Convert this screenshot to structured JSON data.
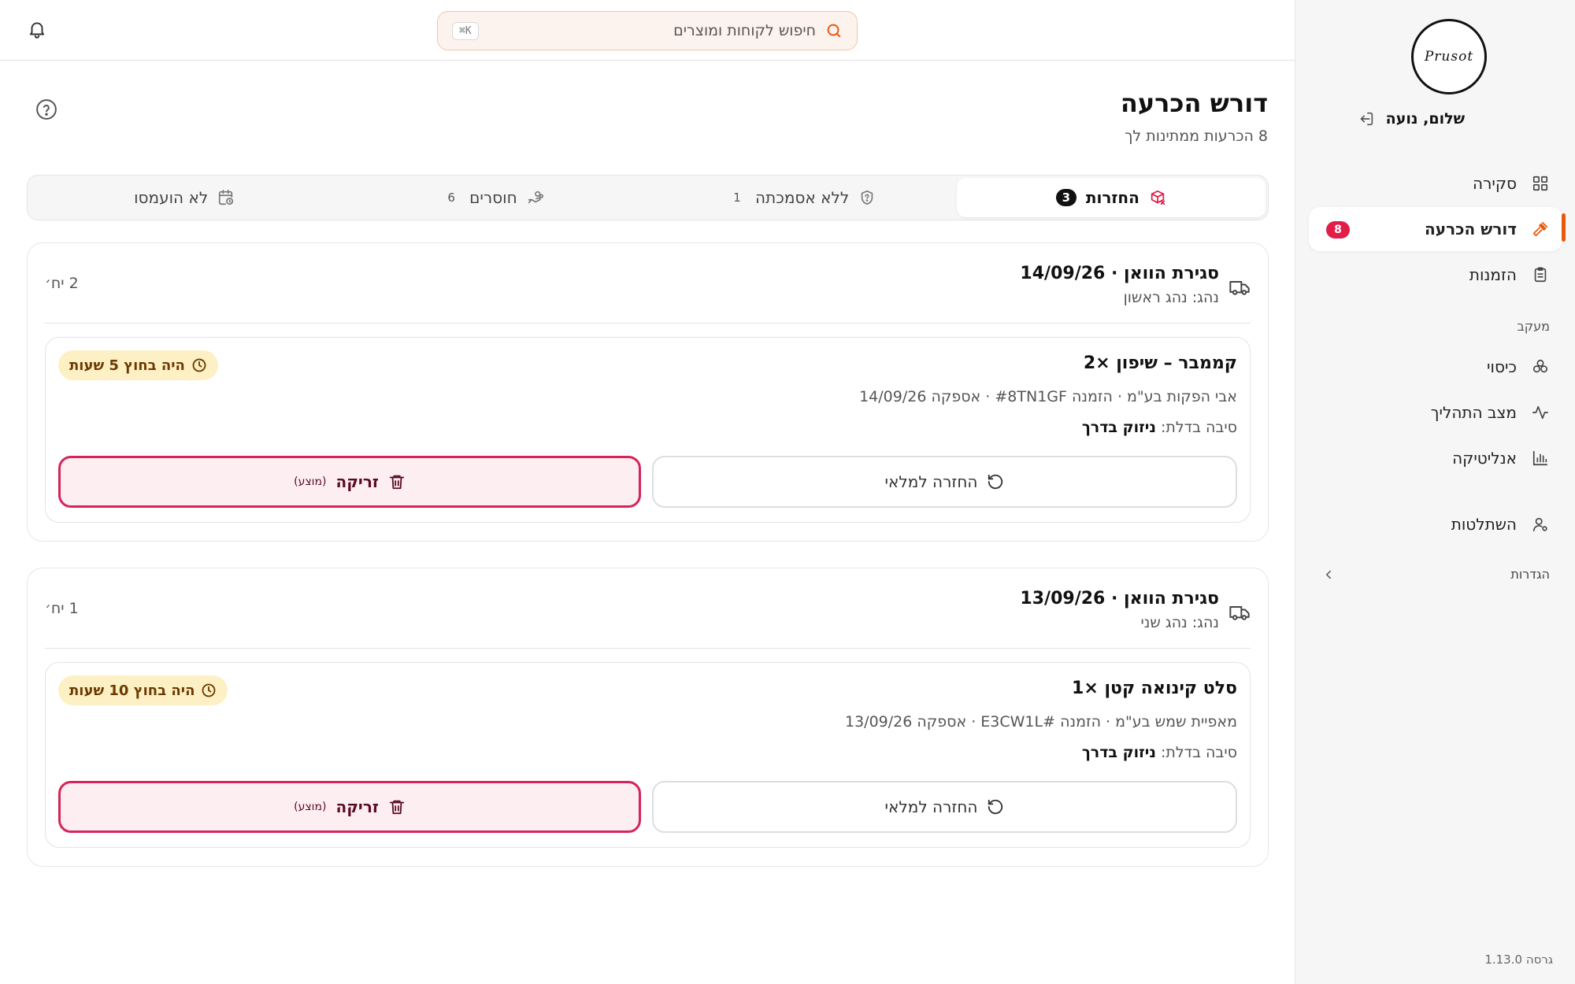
{
  "sidebar": {
    "logo_text": "Prusot",
    "greeting": "שלום, נועה",
    "nav": [
      {
        "label": "סקירה",
        "icon": "grid-icon"
      },
      {
        "label": "דורש הכרעה",
        "icon": "gavel-icon",
        "badge": "8"
      },
      {
        "label": "הזמנות",
        "icon": "clipboard-icon"
      }
    ],
    "section_label": "מעקב",
    "tracking": [
      {
        "label": "כיסוי",
        "icon": "boxes-icon"
      },
      {
        "label": "מצב התהליך",
        "icon": "activity-icon"
      },
      {
        "label": "אנליטיקה",
        "icon": "bar-chart-icon"
      }
    ],
    "admin": {
      "label": "השתלטות",
      "icon": "user-cog-icon"
    },
    "settings_label": "הגדרות",
    "version": "גרסה 1.13.0"
  },
  "topbar": {
    "search_placeholder": "חיפוש לקוחות ומוצרים",
    "search_shortcut": "⌘K"
  },
  "page": {
    "title": "דורש הכרעה",
    "subtitle": "8 הכרעות ממתינות לך"
  },
  "tabs": [
    {
      "label": "החזרות",
      "count": "3",
      "icon": "package-x-icon",
      "active": true
    },
    {
      "label": "ללא אסמכתה",
      "count": "1",
      "icon": "shield-question-icon"
    },
    {
      "label": "חוסרים",
      "count": "6",
      "icon": "hand-coins-icon"
    },
    {
      "label": "לא הועמסו",
      "count": "",
      "icon": "calendar-clock-icon"
    }
  ],
  "cards": [
    {
      "title": "סגירת הוואן · 14/09/26",
      "driver": "נהג: נהג ראשון",
      "units": "2 יח׳",
      "item": {
        "name": "קממבר – שיפון ×2",
        "meta": "אבי הפקות בע\"מ · הזמנה #8TN1GF · אספקה 14/09/26",
        "reason_label": "סיבה בדלת:",
        "reason_value": "ניזוק בדרך",
        "time_badge": "היה בחוץ 5 שעות",
        "restock_label": "החזרה למלאי",
        "discard_label": "זריקה",
        "discard_hint": "(מוצע)"
      }
    },
    {
      "title": "סגירת הוואן · 13/09/26",
      "driver": "נהג: נהג שני",
      "units": "1 יח׳",
      "item": {
        "name": "סלט קינואה קטן ×1",
        "meta": "מאפיית שמש בע\"מ · הזמנה #E3CW1L · אספקה 13/09/26",
        "reason_label": "סיבה בדלת:",
        "reason_value": "ניזוק בדרך",
        "time_badge": "היה בחוץ 10 שעות",
        "restock_label": "החזרה למלאי",
        "discard_label": "זריקה",
        "discard_hint": "(מוצע)"
      }
    }
  ],
  "colors": {
    "accent": "#e8590c",
    "danger": "#d6245a",
    "badge_bg": "#e11d48",
    "warning_bg": "#fdf0c4"
  }
}
